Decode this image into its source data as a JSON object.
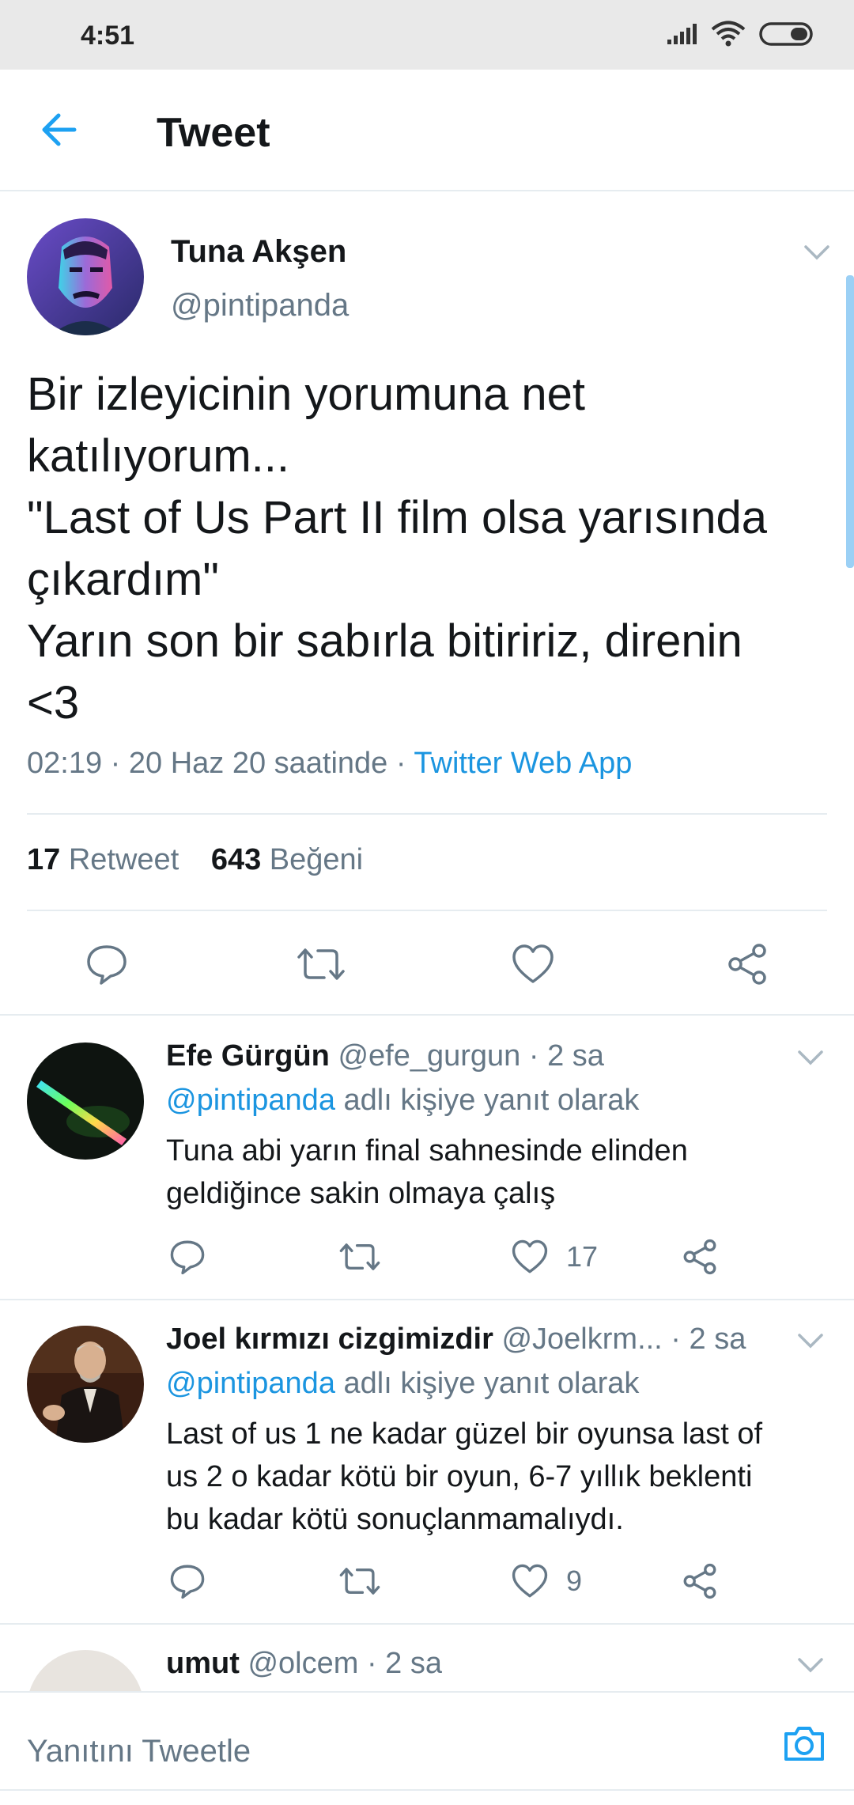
{
  "status_bar": {
    "time": "4:51",
    "icons": [
      "signal-icon",
      "wifi-icon",
      "battery-icon"
    ]
  },
  "header": {
    "title": "Tweet",
    "back_icon": "arrow-left-icon"
  },
  "main_tweet": {
    "author_name": "Tuna Akşen",
    "author_handle": "@pintipanda",
    "text_lines": [
      "Bir izleyicinin yorumuna net",
      "katılıyorum...",
      "\"Last of Us Part II film olsa yarısında",
      "çıkardım\"",
      "Yarın son bir sabırla bitiririz, direnin",
      "<3"
    ],
    "time": "02:19 · 20 Haz 20 saatinde · ",
    "source": "Twitter Web App",
    "retweet_count": "17",
    "retweet_label": "Retweet",
    "like_count": "643",
    "like_label": "Beğeni"
  },
  "replies": [
    {
      "name": "Efe Gürgün",
      "handle": "@efe_gurgun",
      "time": " · 2 sa",
      "reply_to_handle": "@pintipanda",
      "reply_to_suffix": " adlı kişiye yanıt olarak",
      "text_lines": [
        "Tuna abi yarın final sahnesinde elinden",
        "geldiğince sakin olmaya çalış"
      ],
      "like_count": "17"
    },
    {
      "name": "Joel kırmızı cizgimizdir",
      "handle": "@Joelkrm...",
      "time": " · 2 sa",
      "reply_to_handle": "@pintipanda",
      "reply_to_suffix": " adlı kişiye yanıt olarak",
      "text_lines": [
        "Last of us 1 ne kadar güzel bir oyunsa last of",
        "us 2 o kadar kötü bir oyun, 6-7 yıllık beklenti",
        "bu kadar kötü sonuçlanmamalıydı."
      ],
      "like_count": "9"
    },
    {
      "name": "umut",
      "handle": "@olcem",
      "time": " · 2 sa"
    }
  ],
  "composer": {
    "placeholder": "Yanıtını Tweetle",
    "camera_icon": "camera-icon"
  },
  "colors": {
    "accent": "#1b95e0",
    "muted": "#657786",
    "divider": "#e6ecf0",
    "text": "#14171a"
  }
}
